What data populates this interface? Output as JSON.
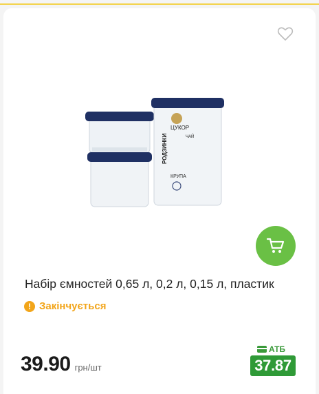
{
  "product": {
    "title": "Набір ємностей 0,65 л, 0,2 л, 0,15 л, пластик",
    "status": "Закінчується",
    "price": "39.90",
    "unit": "грн/шт",
    "atb_label": "АТБ",
    "atb_price": "37.87",
    "image_labels": [
      "ЦУКОР",
      "ЧАЙ",
      "КРУПА",
      "РОДЗИНКИ"
    ]
  },
  "icons": {
    "favorite": "heart-outline-icon",
    "cart": "shopping-cart-icon",
    "status": "warning-icon",
    "atb": "card-icon"
  },
  "colors": {
    "accent_green": "#6ac045",
    "atb_green": "#2f9a37",
    "warning": "#f2a51a",
    "top_border": "#f3d34a"
  }
}
